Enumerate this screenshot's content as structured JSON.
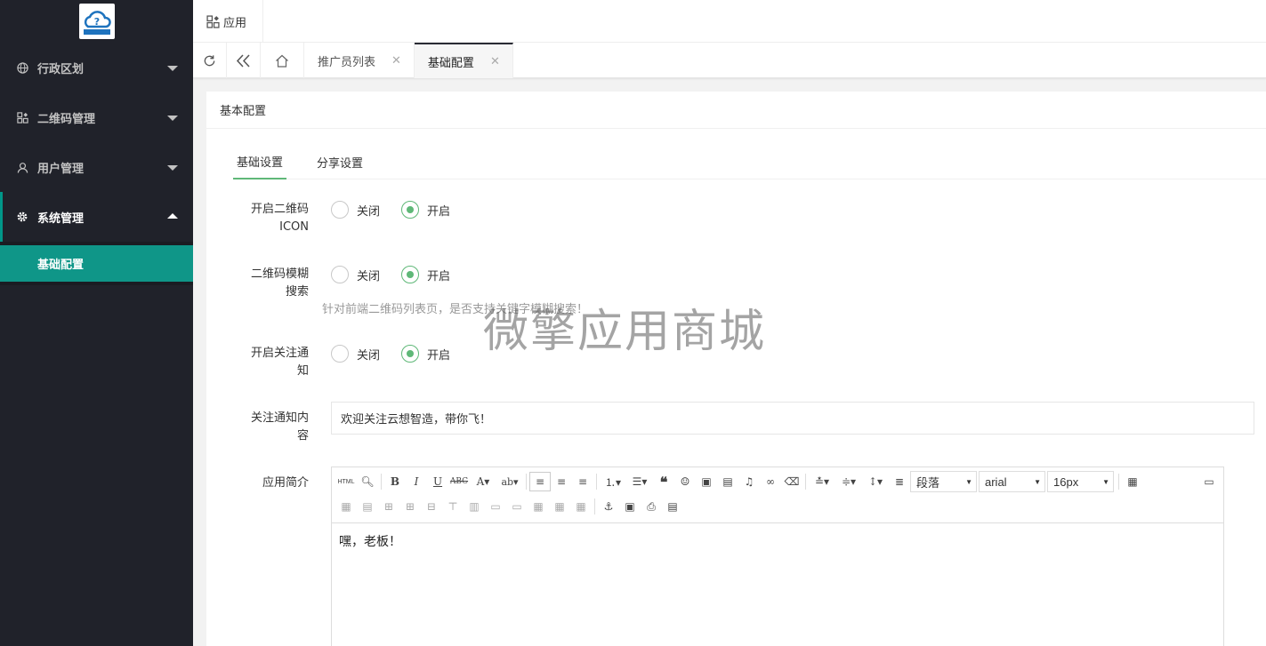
{
  "sidebar": {
    "items": [
      {
        "label": "行政区划",
        "icon": "globe-icon"
      },
      {
        "label": "二维码管理",
        "icon": "qrcode-icon"
      },
      {
        "label": "用户管理",
        "icon": "user-icon"
      },
      {
        "label": "系统管理",
        "icon": "gear-icon"
      }
    ],
    "sub_items": [
      {
        "label": "基础配置"
      }
    ]
  },
  "header": {
    "app_label": "应用"
  },
  "tabs": [
    {
      "label": "推广员列表"
    },
    {
      "label": "基础配置"
    }
  ],
  "card": {
    "title": "基本配置",
    "subtabs": [
      {
        "label": "基础设置"
      },
      {
        "label": "分享设置"
      }
    ]
  },
  "form": {
    "qrcode_icon": {
      "label_line1": "开启二维码",
      "label_line2": "ICON",
      "off": "关闭",
      "on": "开启",
      "value": "开启"
    },
    "qrcode_fuzzy": {
      "label_line1": "二维码模糊",
      "label_line2": "搜索",
      "off": "关闭",
      "on": "开启",
      "value": "开启",
      "hint": "针对前端二维码列表页，是否支持关键字模糊搜索！"
    },
    "follow_notify": {
      "label_line1": "开启关注通",
      "label_line2": "知",
      "off": "关闭",
      "on": "开启",
      "value": "开启"
    },
    "follow_content": {
      "label_line1": "关注通知内",
      "label_line2": "容",
      "value": "欢迎关注云想智造，带你飞！"
    },
    "app_intro": {
      "label": "应用简介",
      "content": "嘿，老板！"
    }
  },
  "editor": {
    "paragraph": "段落",
    "font_family": "arial",
    "font_size": "16px"
  },
  "watermark": "微擎应用商城",
  "colors": {
    "sidebar_bg": "#20222a",
    "accent": "#009688",
    "radio_on": "#5fb878"
  }
}
